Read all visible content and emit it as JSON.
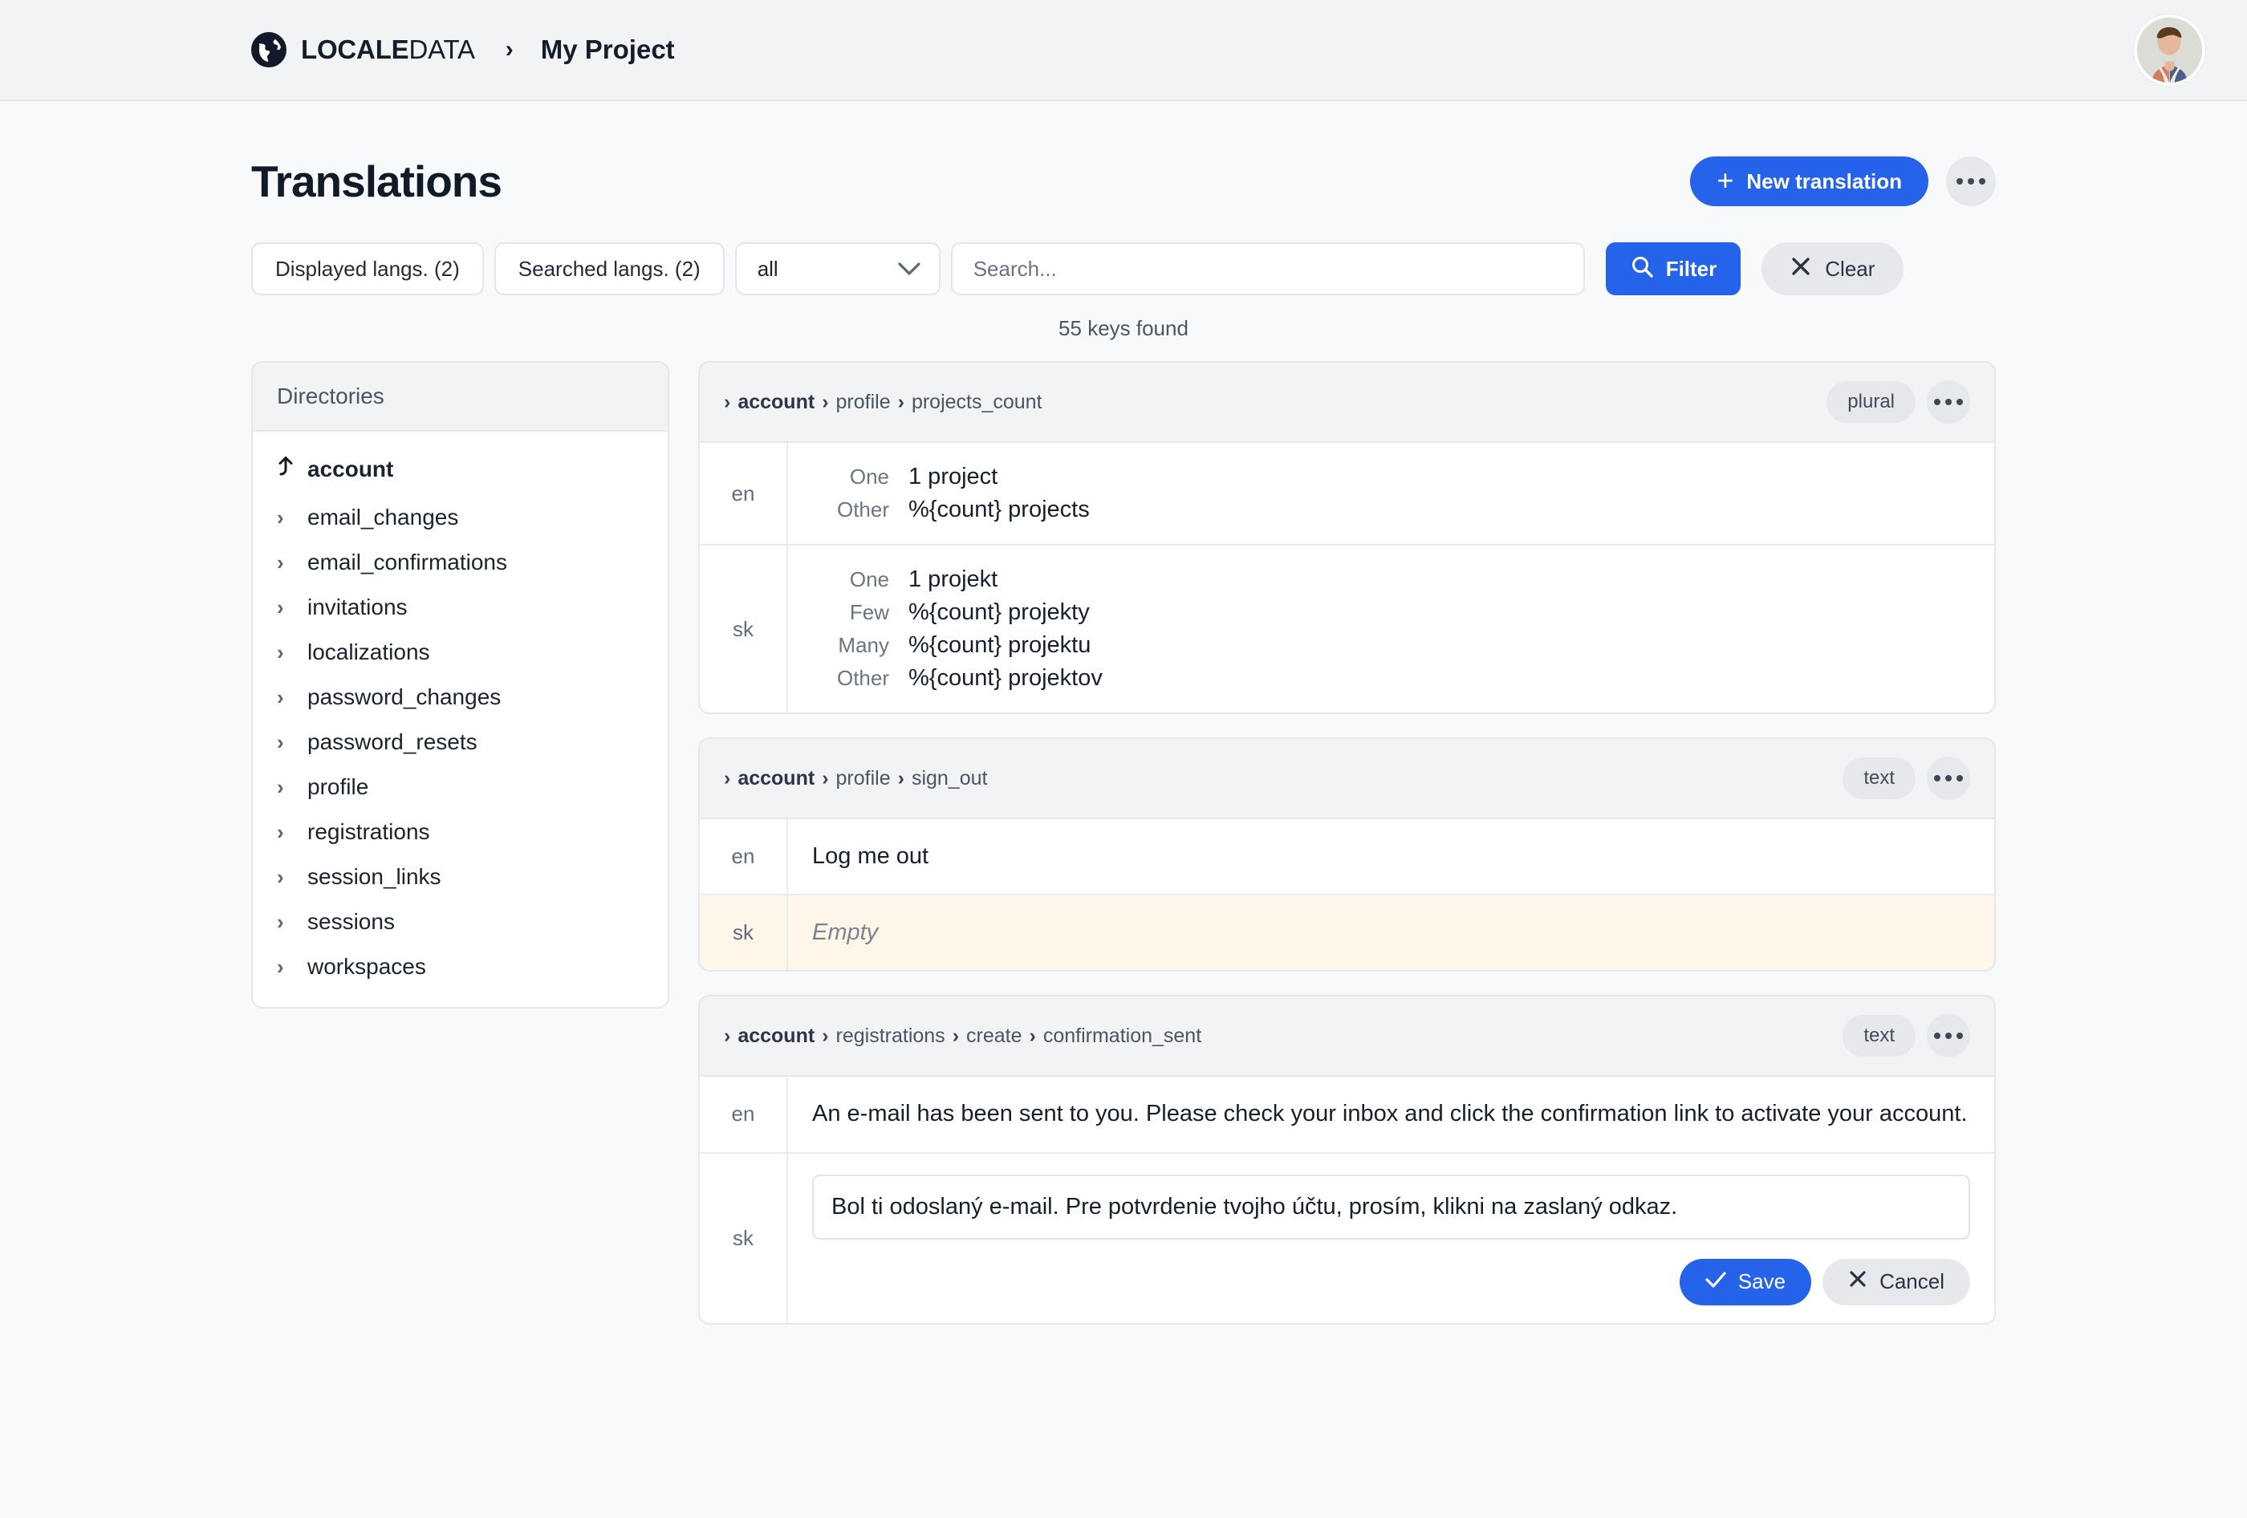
{
  "topbar": {
    "brand_bold": "LOCALE",
    "brand_light": "DATA",
    "separator": "›",
    "project": "My Project",
    "globe_icon": "globe-icon",
    "avatar_icon": "user-avatar-photo"
  },
  "header": {
    "title": "Translations",
    "new_translation_label": "New translation",
    "plus_icon": "+",
    "more_icon": "ellipsis-icon"
  },
  "filters": {
    "displayed_langs_label": "Displayed langs. (2)",
    "searched_langs_label": "Searched langs. (2)",
    "select_value": "all",
    "select_options": [
      "all"
    ],
    "chevron_icon": "chevron-down-icon",
    "search_placeholder": "Search...",
    "search_value": "",
    "filter_label": "Filter",
    "filter_icon": "search-icon",
    "clear_label": "Clear",
    "clear_icon": "close-icon",
    "results_text": "55 keys found"
  },
  "sidebar": {
    "title": "Directories",
    "parent": {
      "label": "account",
      "icon": "arrow-up-icon"
    },
    "items": [
      {
        "label": "email_changes",
        "icon": "chevron-right-icon"
      },
      {
        "label": "email_confirmations",
        "icon": "chevron-right-icon"
      },
      {
        "label": "invitations",
        "icon": "chevron-right-icon"
      },
      {
        "label": "localizations",
        "icon": "chevron-right-icon"
      },
      {
        "label": "password_changes",
        "icon": "chevron-right-icon"
      },
      {
        "label": "password_resets",
        "icon": "chevron-right-icon"
      },
      {
        "label": "profile",
        "icon": "chevron-right-icon"
      },
      {
        "label": "registrations",
        "icon": "chevron-right-icon"
      },
      {
        "label": "session_links",
        "icon": "chevron-right-icon"
      },
      {
        "label": "sessions",
        "icon": "chevron-right-icon"
      },
      {
        "label": "workspaces",
        "icon": "chevron-right-icon"
      }
    ]
  },
  "cards": [
    {
      "breadcrumb": [
        "account",
        "profile",
        "projects_count"
      ],
      "badge": "plural",
      "langs": [
        {
          "code": "en",
          "type": "plural",
          "forms": [
            {
              "key": "One",
              "value": "1 project"
            },
            {
              "key": "Other",
              "value": "%{count} projects"
            }
          ]
        },
        {
          "code": "sk",
          "type": "plural",
          "forms": [
            {
              "key": "One",
              "value": "1 projekt"
            },
            {
              "key": "Few",
              "value": "%{count} projekty"
            },
            {
              "key": "Many",
              "value": "%{count} projektu"
            },
            {
              "key": "Other",
              "value": "%{count} projektov"
            }
          ]
        }
      ]
    },
    {
      "breadcrumb": [
        "account",
        "profile",
        "sign_out"
      ],
      "badge": "text",
      "langs": [
        {
          "code": "en",
          "type": "text",
          "value": "Log me out"
        },
        {
          "code": "sk",
          "type": "empty",
          "value": "Empty"
        }
      ]
    },
    {
      "breadcrumb": [
        "account",
        "registrations",
        "create",
        "confirmation_sent"
      ],
      "badge": "text",
      "langs": [
        {
          "code": "en",
          "type": "text",
          "value": "An e-mail has been sent to you. Please check your inbox and click the confirmation link to activate your account."
        },
        {
          "code": "sk",
          "type": "editing",
          "value": "Bol ti odoslaný e-mail. Pre potvrdenie tvojho účtu, prosím, klikni na zaslaný odkaz.",
          "save_label": "Save",
          "cancel_label": "Cancel"
        }
      ]
    }
  ],
  "colors": {
    "accent": "#2563eb",
    "topbar_bg": "#f1f3f5",
    "page_bg": "#f8f9fb",
    "empty_row_bg": "#fdf6e9"
  }
}
